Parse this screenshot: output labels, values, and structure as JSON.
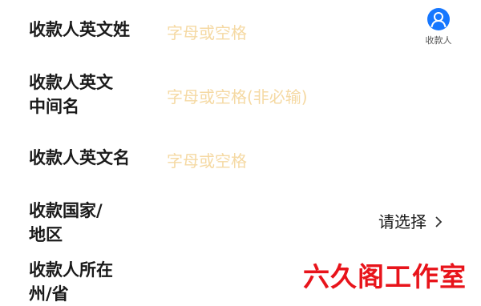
{
  "form": {
    "rows": [
      {
        "label_lines": [
          "收款人英文姓"
        ],
        "placeholder": "字母或空格"
      },
      {
        "label_lines": [
          "收款人英文",
          "中间名"
        ],
        "placeholder": "字母或空格(非必输)"
      },
      {
        "label_lines": [
          "收款人英文名"
        ],
        "placeholder": "字母或空格"
      },
      {
        "label_lines": [
          "收款国家/",
          "地区"
        ],
        "select_value": "请选择"
      },
      {
        "label_lines": [
          "收款人所在",
          "州/省"
        ]
      }
    ]
  },
  "payee_button": {
    "label": "收款人",
    "icon": "person-icon",
    "color": "#1677ff"
  },
  "watermark": {
    "text": "六久阁工作室",
    "color": "#e8141b"
  },
  "colors": {
    "placeholder": "#f5d9a3",
    "text": "#1a1a1a"
  }
}
